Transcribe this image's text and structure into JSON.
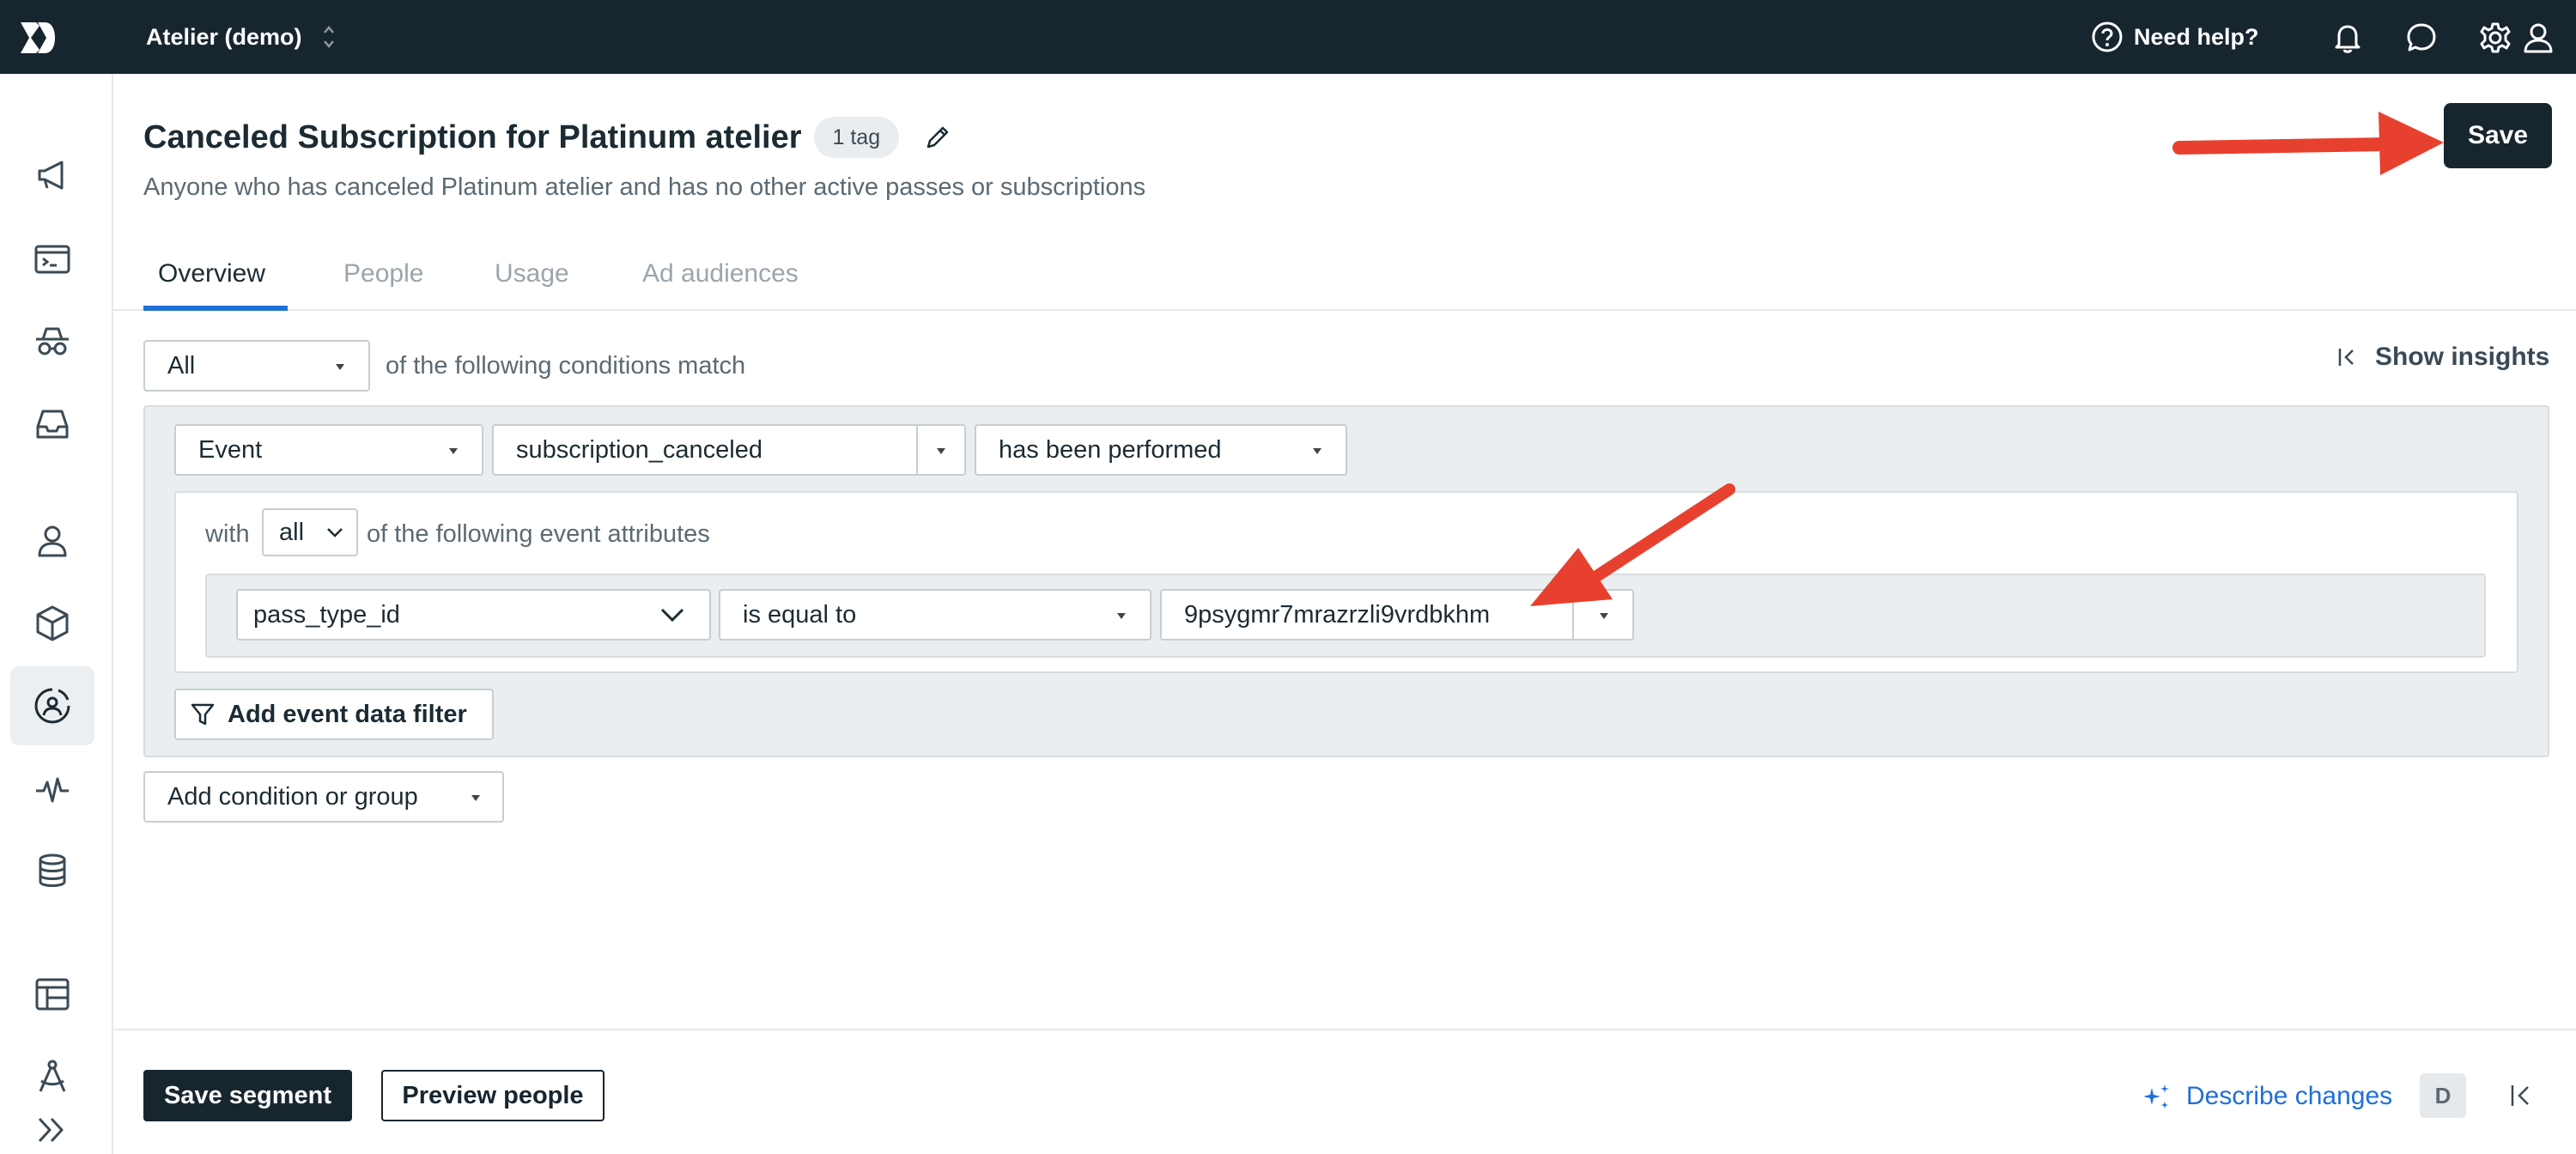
{
  "topbar": {
    "workspace": "Atelier (demo)",
    "help_label": "Need help?"
  },
  "segment": {
    "title": "Canceled Subscription for Platinum atelier",
    "tag_count": "1 tag",
    "description": "Anyone who has canceled Platinum atelier and has no other active passes or subscriptions",
    "save_label": "Save"
  },
  "tabs": [
    {
      "label": "Overview",
      "active": true
    },
    {
      "label": "People",
      "active": false
    },
    {
      "label": "Usage",
      "active": false
    },
    {
      "label": "Ad audiences",
      "active": false
    }
  ],
  "conditions": {
    "match_value": "All",
    "match_text": "of the following conditions match",
    "show_insights": "Show insights",
    "type": "Event",
    "event_name": "subscription_canceled",
    "performed": "has been performed",
    "with_label": "with",
    "attr_match": "all",
    "attr_text": "of the following event attributes",
    "attr_key": "pass_type_id",
    "operator": "is equal to",
    "attr_value": "9psygmr7mrazrzli9vrdbkhm",
    "add_filter": "Add event data filter",
    "add_condition": "Add condition or group"
  },
  "footer": {
    "save_segment": "Save segment",
    "preview_people": "Preview people",
    "describe_changes": "Describe changes",
    "shortcut": "D"
  },
  "colors": {
    "topbar": "#17252f",
    "accent": "#1f6fd6",
    "annotation_arrow": "#e8402e"
  },
  "nav_icons": [
    "megaphone-icon",
    "terminal-icon",
    "spy-icon",
    "inbox-icon",
    "person-icon",
    "cube-icon",
    "segments-icon",
    "activity-icon",
    "database-icon",
    "table-icon",
    "compass-icon",
    "expand-icon"
  ]
}
